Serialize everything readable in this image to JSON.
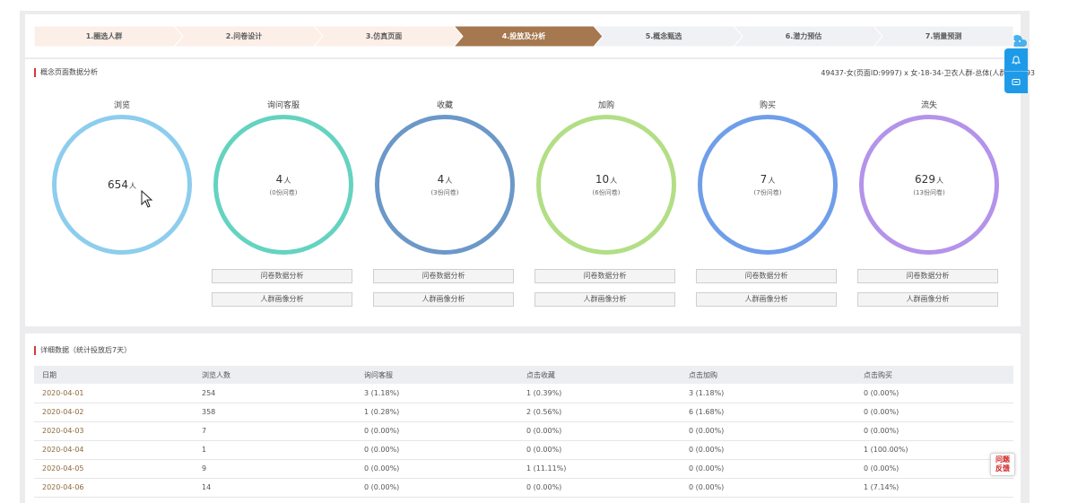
{
  "steps": [
    {
      "label": "1.圈选人群",
      "state": "done"
    },
    {
      "label": "2.问卷设计",
      "state": "done"
    },
    {
      "label": "3.仿真页面",
      "state": "done"
    },
    {
      "label": "4.投放及分析",
      "state": "active"
    },
    {
      "label": "5.概念甄选",
      "state": "todo"
    },
    {
      "label": "6.潜力预估",
      "state": "todo"
    },
    {
      "label": "7.销量预测",
      "state": "todo"
    }
  ],
  "colors": {
    "done": "#fcefe8",
    "active": "#a5784f",
    "todo": "#f0f1f4",
    "accent": "#d13a3a"
  },
  "concept": {
    "title": "概念页面数据分析",
    "page_info": "49437-女(页面ID:9997) x 女-18-34-卫衣人群-总体(人群ID:1893",
    "metrics": [
      {
        "label": "浏览",
        "count": "654",
        "unit": "人",
        "sub": "",
        "color": "#8dcdee",
        "buttons": false
      },
      {
        "label": "询问客服",
        "count": "4",
        "unit": "人",
        "sub": "(0份问卷)",
        "color": "#64d3c0",
        "buttons": true
      },
      {
        "label": "收藏",
        "count": "4",
        "unit": "人",
        "sub": "(3份问卷)",
        "color": "#6c98c8",
        "buttons": true
      },
      {
        "label": "加购",
        "count": "10",
        "unit": "人",
        "sub": "(6份问卷)",
        "color": "#b2de85",
        "buttons": true
      },
      {
        "label": "购买",
        "count": "7",
        "unit": "人",
        "sub": "(7份问卷)",
        "color": "#6f9eea",
        "buttons": true
      },
      {
        "label": "流失",
        "count": "629",
        "unit": "人",
        "sub": "(13份问卷)",
        "color": "#b493ea",
        "buttons": true
      }
    ],
    "btn_survey": "问卷数据分析",
    "btn_portrait": "人群画像分析"
  },
  "detail": {
    "title": "详细数据（统计投放后7天）",
    "columns": [
      "日期",
      "浏览人数",
      "询问客服",
      "点击收藏",
      "点击加购",
      "点击购买"
    ],
    "rows": [
      [
        "2020-04-01",
        "254",
        "3 (1.18%)",
        "1 (0.39%)",
        "3 (1.18%)",
        "0 (0.00%)"
      ],
      [
        "2020-04-02",
        "358",
        "1 (0.28%)",
        "2 (0.56%)",
        "6 (1.68%)",
        "0 (0.00%)"
      ],
      [
        "2020-04-03",
        "7",
        "0 (0.00%)",
        "0 (0.00%)",
        "0 (0.00%)",
        "0 (0.00%)"
      ],
      [
        "2020-04-04",
        "1",
        "0 (0.00%)",
        "0 (0.00%)",
        "0 (0.00%)",
        "1 (100.00%)"
      ],
      [
        "2020-04-05",
        "9",
        "0 (0.00%)",
        "1 (11.11%)",
        "0 (0.00%)",
        "0 (0.00%)"
      ],
      [
        "2020-04-06",
        "14",
        "0 (0.00%)",
        "0 (0.00%)",
        "0 (0.00%)",
        "1 (7.14%)"
      ]
    ]
  },
  "feedback": {
    "line1": "问题",
    "line2": "反馈"
  }
}
